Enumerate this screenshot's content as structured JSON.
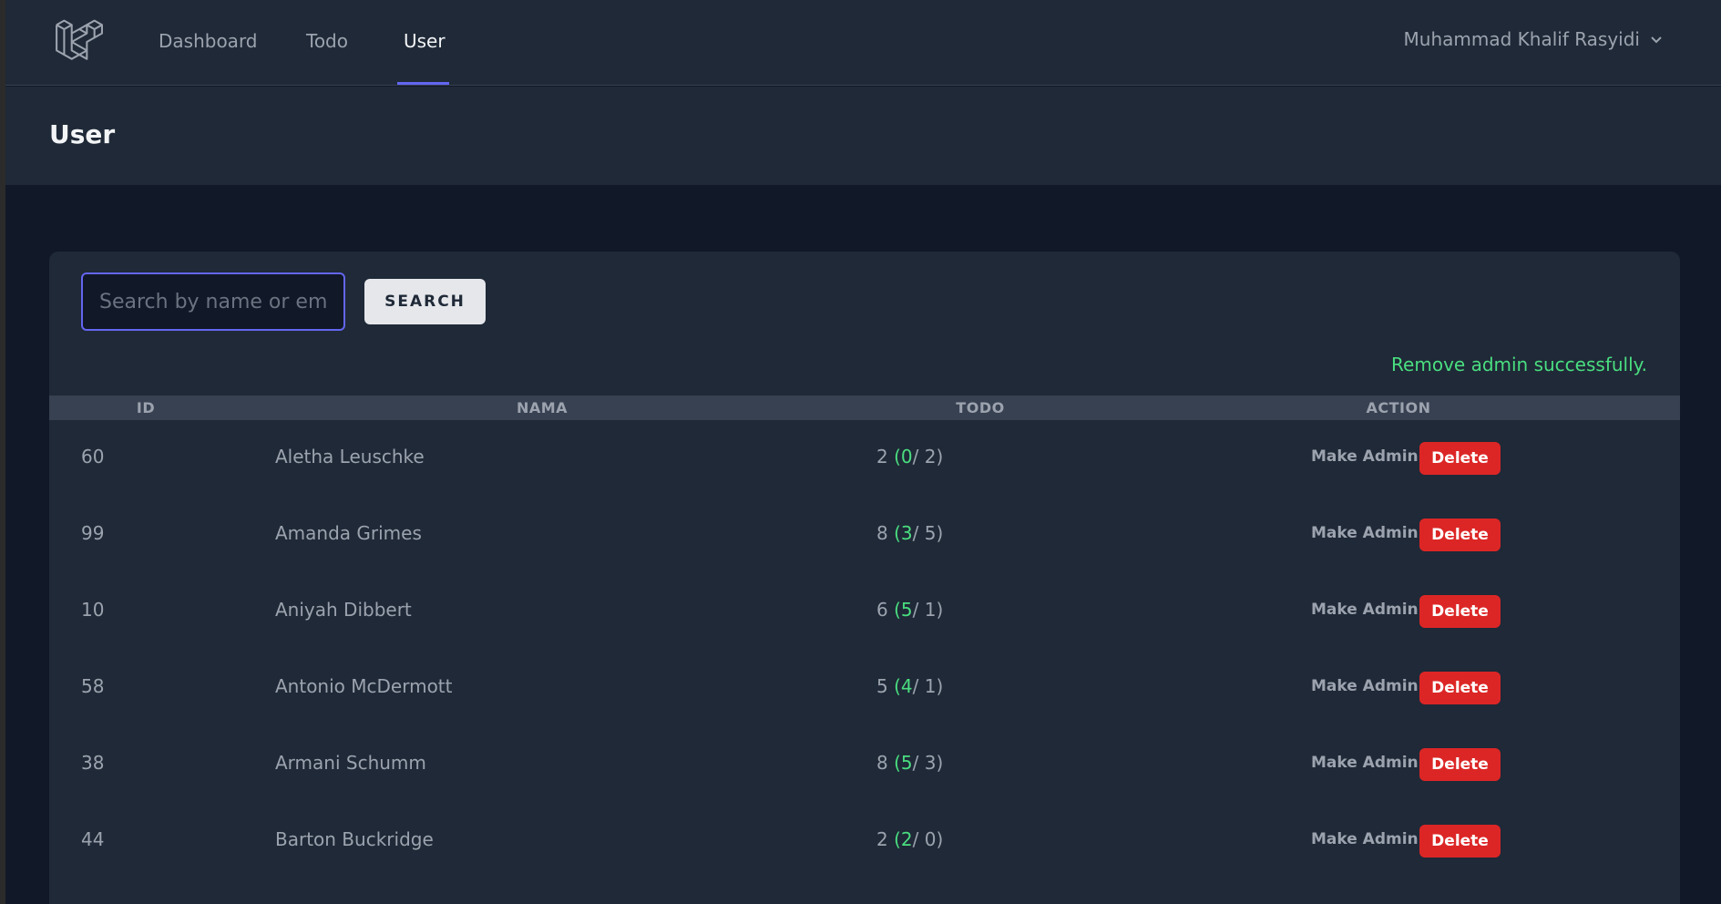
{
  "nav": {
    "links": [
      {
        "label": "Dashboard"
      },
      {
        "label": "Todo"
      },
      {
        "label": "User"
      }
    ],
    "user_name": "Muhammad Khalif Rasyidi"
  },
  "header": {
    "title": "User"
  },
  "search": {
    "placeholder": "Search by name or email",
    "value": "",
    "button_label": "SEARCH"
  },
  "flash_message": "Remove admin successfully.",
  "table": {
    "columns": [
      "ID",
      "NAMA",
      "TODO",
      "ACTION"
    ],
    "make_admin_label": "Make Admin",
    "delete_label": "Delete",
    "rows": [
      {
        "id": "60",
        "name": "Aletha Leuschke",
        "todo_total": "2",
        "todo_done": "0",
        "todo_pending": "2"
      },
      {
        "id": "99",
        "name": "Amanda Grimes",
        "todo_total": "8",
        "todo_done": "3",
        "todo_pending": "5"
      },
      {
        "id": "10",
        "name": "Aniyah Dibbert",
        "todo_total": "6",
        "todo_done": "5",
        "todo_pending": "1"
      },
      {
        "id": "58",
        "name": "Antonio McDermott",
        "todo_total": "5",
        "todo_done": "4",
        "todo_pending": "1"
      },
      {
        "id": "38",
        "name": "Armani Schumm",
        "todo_total": "8",
        "todo_done": "5",
        "todo_pending": "3"
      },
      {
        "id": "44",
        "name": "Barton Buckridge",
        "todo_total": "2",
        "todo_done": "2",
        "todo_pending": "0"
      }
    ]
  },
  "colors": {
    "accent": "#6366f1",
    "success": "#4ade80",
    "danger": "#dc2626"
  }
}
